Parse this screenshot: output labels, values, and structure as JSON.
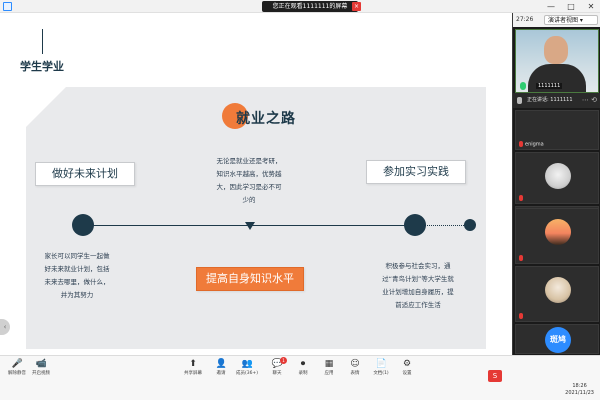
{
  "window": {
    "share_banner": "您正在观看1111111的屏幕",
    "stop_label": "×",
    "buttons": [
      "—",
      "□",
      "✕"
    ]
  },
  "slide": {
    "brand": "学生学业",
    "title": "就业之路",
    "box_plan": "做好未来计划",
    "box_practice": "参加实习实践",
    "box_improve": "提高自身知识水平",
    "note_mid": "无论是就业还是考研，知识水平越高，优势越大，因此学习是必不可少的",
    "note_left": "家长可以同学生一起做好未来就业计划，包括未来去哪里，做什么，并为其努力",
    "note_right": "积极参与社会实习，通过“青鸟计划”等大学生就业计划增加自身履历，提前适应工作生活",
    "side_tab": "‹",
    "colors": {
      "navy": "#1e3a4a",
      "orange": "#f07b3a",
      "panel": "#e9eaec"
    }
  },
  "participants": {
    "timer": "27:26",
    "layout_label": "演讲者视图 ▾",
    "main_video_name": "1111111",
    "speaking_label": "正在讲话: 1111111",
    "speaking_buttons": "⋯ ⟲",
    "tiles": [
      {
        "name": "enigma",
        "avatar": ""
      },
      {
        "name": "",
        "avatar": "cat"
      },
      {
        "name": "11",
        "avatar": ""
      },
      {
        "name": "",
        "avatar": "sunset"
      },
      {
        "name": "",
        "avatar": "girl"
      },
      {
        "name": "",
        "avatar_text": "斑鸠"
      }
    ]
  },
  "toolbar": {
    "items": [
      {
        "icon": "mic-icon",
        "glyph": "🎤",
        "label": "解除静音"
      },
      {
        "icon": "video-icon",
        "glyph": "📹",
        "label": "开启视频"
      },
      {
        "icon": "share-icon",
        "glyph": "⬆",
        "label": "共享屏幕"
      },
      {
        "icon": "invite-icon",
        "glyph": "👤",
        "label": "邀请"
      },
      {
        "icon": "members-icon",
        "glyph": "👥",
        "label": "成员(36+)"
      },
      {
        "icon": "chat-icon",
        "glyph": "💬",
        "label": "聊天"
      },
      {
        "icon": "record-icon",
        "glyph": "⏺",
        "label": "录制"
      },
      {
        "icon": "app-icon",
        "glyph": "▦",
        "label": "应用"
      },
      {
        "icon": "reaction-icon",
        "glyph": "☺",
        "label": "表情"
      },
      {
        "icon": "docs-icon",
        "glyph": "📄",
        "label": "文档(1)"
      },
      {
        "icon": "settings-icon",
        "glyph": "⚙",
        "label": "设置"
      }
    ],
    "chat_badge": "1",
    "ime_label": "S",
    "clock_time": "18:26",
    "clock_date": "2021/11/23"
  }
}
